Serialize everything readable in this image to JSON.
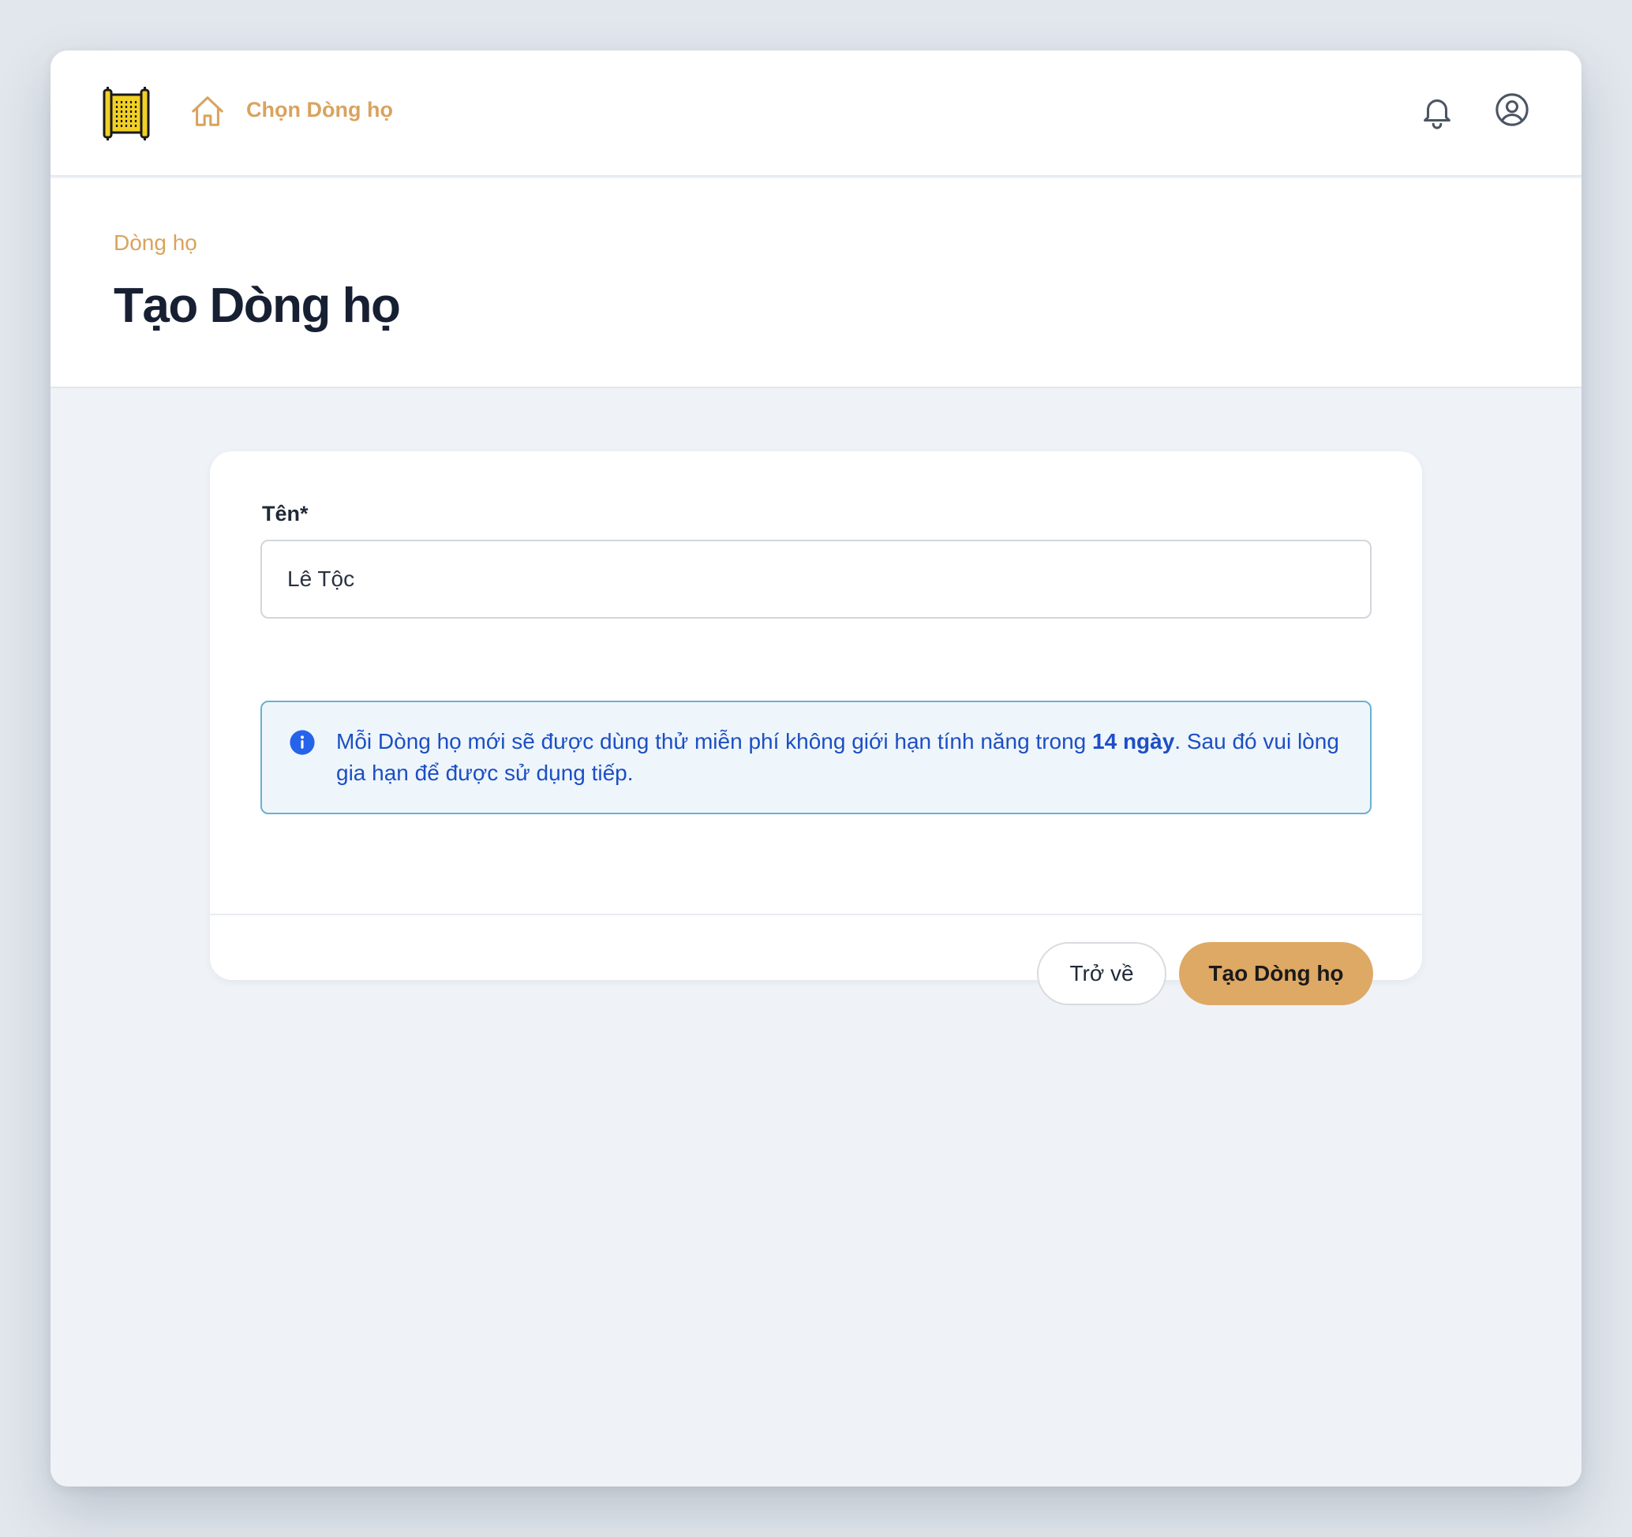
{
  "nav": {
    "logo": "scroll-logo",
    "home_link": "Chọn Dòng họ"
  },
  "header": {
    "breadcrumb": "Dòng họ",
    "title": "Tạo Dòng họ"
  },
  "form": {
    "name_label": "Tên",
    "required_mark": "*",
    "name_value": "Lê Tộc",
    "info_before": "Mỗi Dòng họ mới sẽ được dùng thử miễn phí không giới hạn tính năng trong ",
    "info_bold": "14 ngày",
    "info_after": ". Sau đó vui lòng gia hạn để được sử dụng tiếp.",
    "back_label": "Trở về",
    "submit_label": "Tạo Dòng họ"
  },
  "colors": {
    "accent": "#d9a35e",
    "button_primary": "#dea865",
    "info_text": "#1d4ec4",
    "info_border": "#6bb0d1",
    "info_bg": "#eef6fc",
    "logo_yellow": "#f2d024"
  },
  "icons": [
    "scroll-logo",
    "home-icon",
    "bell-icon",
    "user-circle-icon",
    "info-circle-icon"
  ]
}
